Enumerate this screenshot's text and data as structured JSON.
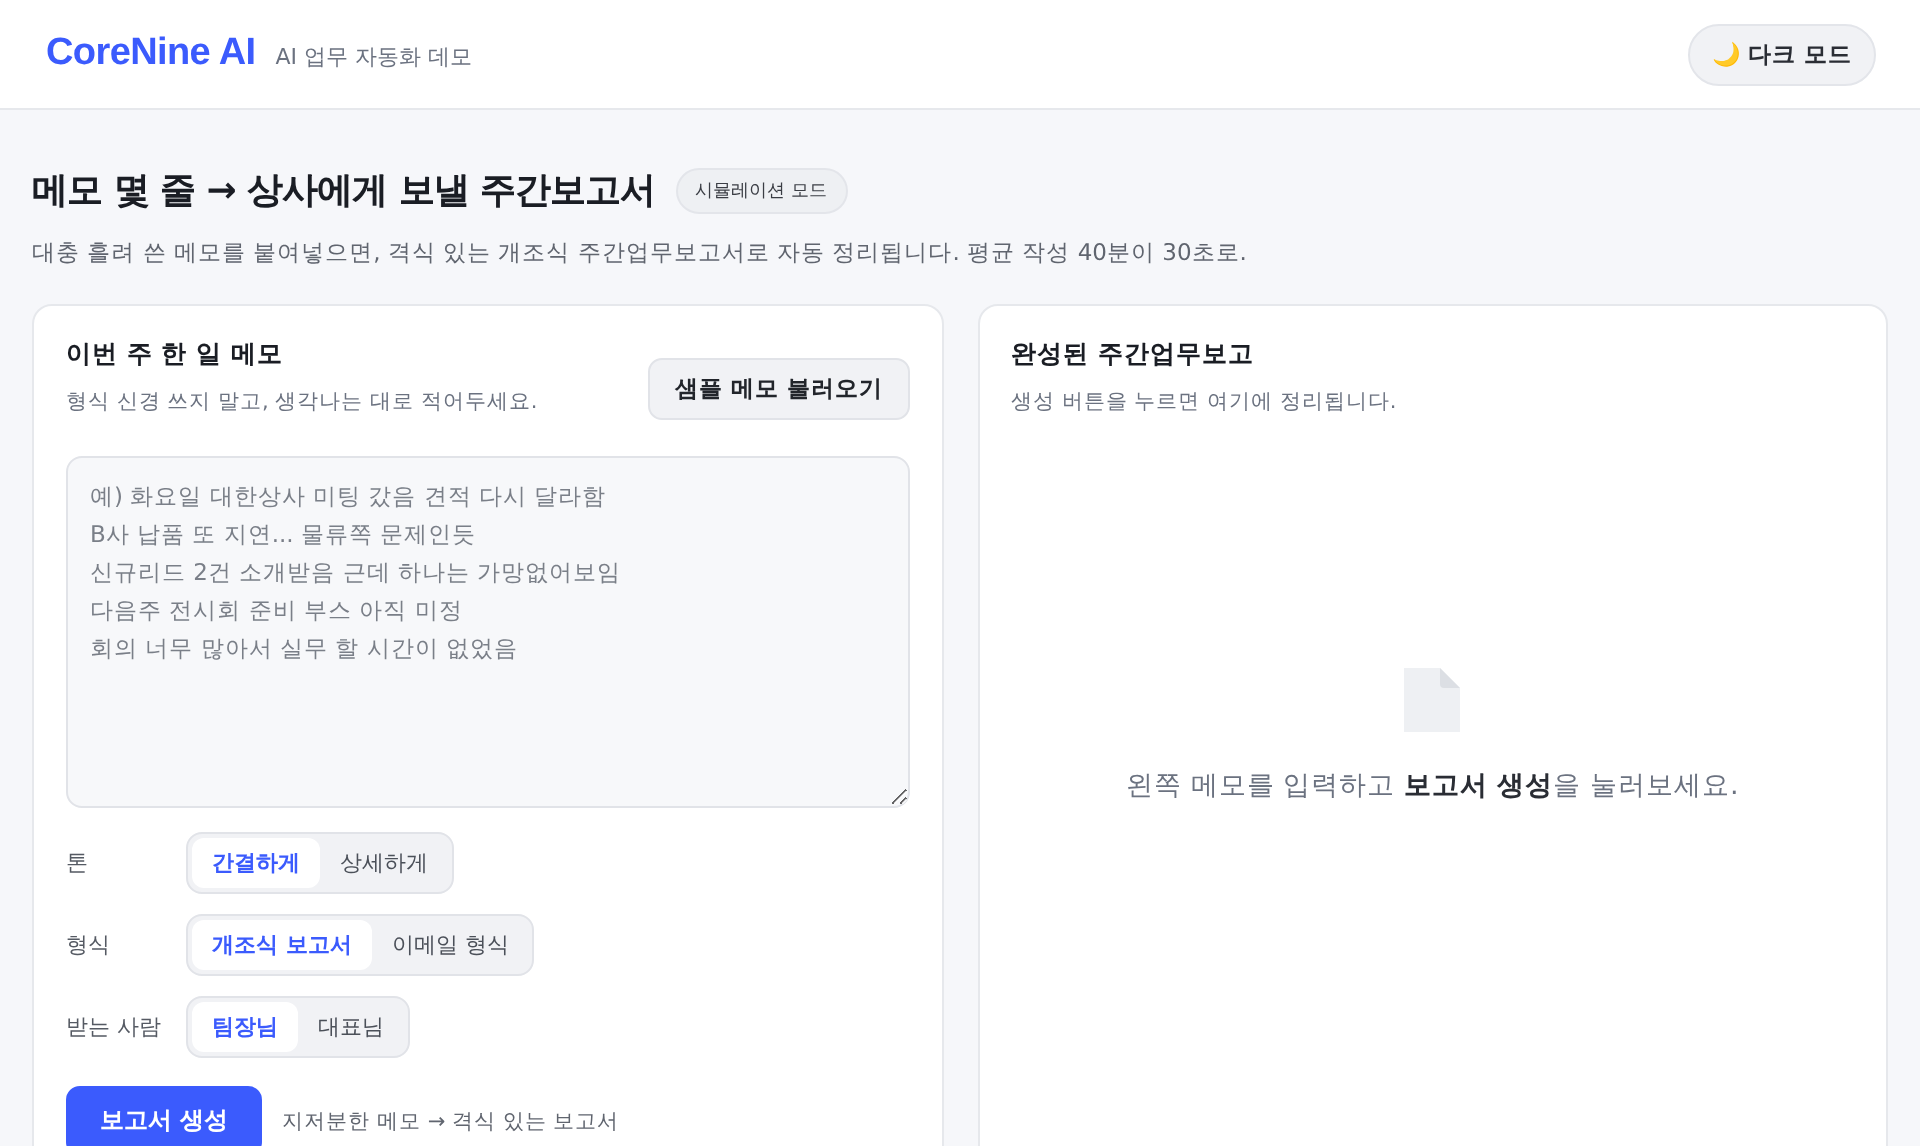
{
  "header": {
    "logo": "CoreNine AI",
    "tagline": "AI 업무 자동화 데모",
    "theme_button": {
      "icon": "🌙",
      "label": "다크 모드"
    }
  },
  "page": {
    "title": "메모 몇 줄 → 상사에게 보낼 주간보고서",
    "badge": "시뮬레이션 모드",
    "subtitle": "대충 흘려 쓴 메모를 붙여넣으면, 격식 있는 개조식 주간업무보고서로 자동 정리됩니다. 평균 작성 40분이 30초로."
  },
  "memo_panel": {
    "title": "이번 주 한 일 메모",
    "hint": "형식 신경 쓰지 말고, 생각나는 대로 적어두세요.",
    "sample_button": "샘플 메모 불러오기",
    "placeholder": "예) 화요일 대한상사 미팅 갔음 견적 다시 달라함\nB사 납품 또 지연... 물류쪽 문제인듯\n신규리드 2건 소개받음 근데 하나는 가망없어보임\n다음주 전시회 준비 부스 아직 미정\n회의 너무 많아서 실무 할 시간이 없었음",
    "options": [
      {
        "label": "톤",
        "choices": [
          {
            "label": "간결하게",
            "selected": true
          },
          {
            "label": "상세하게",
            "selected": false
          }
        ]
      },
      {
        "label": "형식",
        "choices": [
          {
            "label": "개조식 보고서",
            "selected": true
          },
          {
            "label": "이메일 형식",
            "selected": false
          }
        ]
      },
      {
        "label": "받는 사람",
        "choices": [
          {
            "label": "팀장님",
            "selected": true
          },
          {
            "label": "대표님",
            "selected": false
          }
        ]
      }
    ],
    "generate_button": "보고서 생성",
    "generate_note": "지저분한 메모 → 격식 있는 보고서"
  },
  "report_panel": {
    "title": "완성된 주간업무보고",
    "hint": "생성 버튼을 누르면 여기에 정리됩니다.",
    "empty_message": "왼쪽 메모를 입력하고 **보고서 생성**을 눌러보세요."
  }
}
